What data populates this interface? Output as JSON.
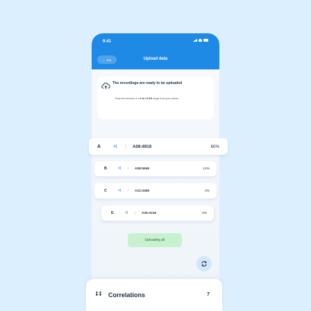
{
  "status_bar": {
    "time": "9:41"
  },
  "header": {
    "back_label": "Exit",
    "title": "Upload data"
  },
  "notice": {
    "title": "The recordings are ready to be uploaded",
    "hint_prefix": "Keep the sensors in a ",
    "hint_range": "2 m / 6.5 ft",
    "hint_suffix": " range from your phone."
  },
  "sensors": [
    {
      "letter": "A",
      "device": "A09:4919",
      "progress": "60%"
    },
    {
      "letter": "B",
      "device": "A08:5946",
      "progress": "13%"
    },
    {
      "letter": "C",
      "device": "A12:3456",
      "progress": "0%"
    },
    {
      "letter": "E",
      "device": "A25:3216",
      "progress": "0%"
    }
  ],
  "upload_button": {
    "label": "Uploading all"
  },
  "correlations": {
    "label": "Correlations",
    "count": "7"
  },
  "colors": {
    "header": "#1f8ae6",
    "bluetooth": "#2b6fe0",
    "upload_button": "#c8f2cf",
    "background": "#dcefff"
  }
}
